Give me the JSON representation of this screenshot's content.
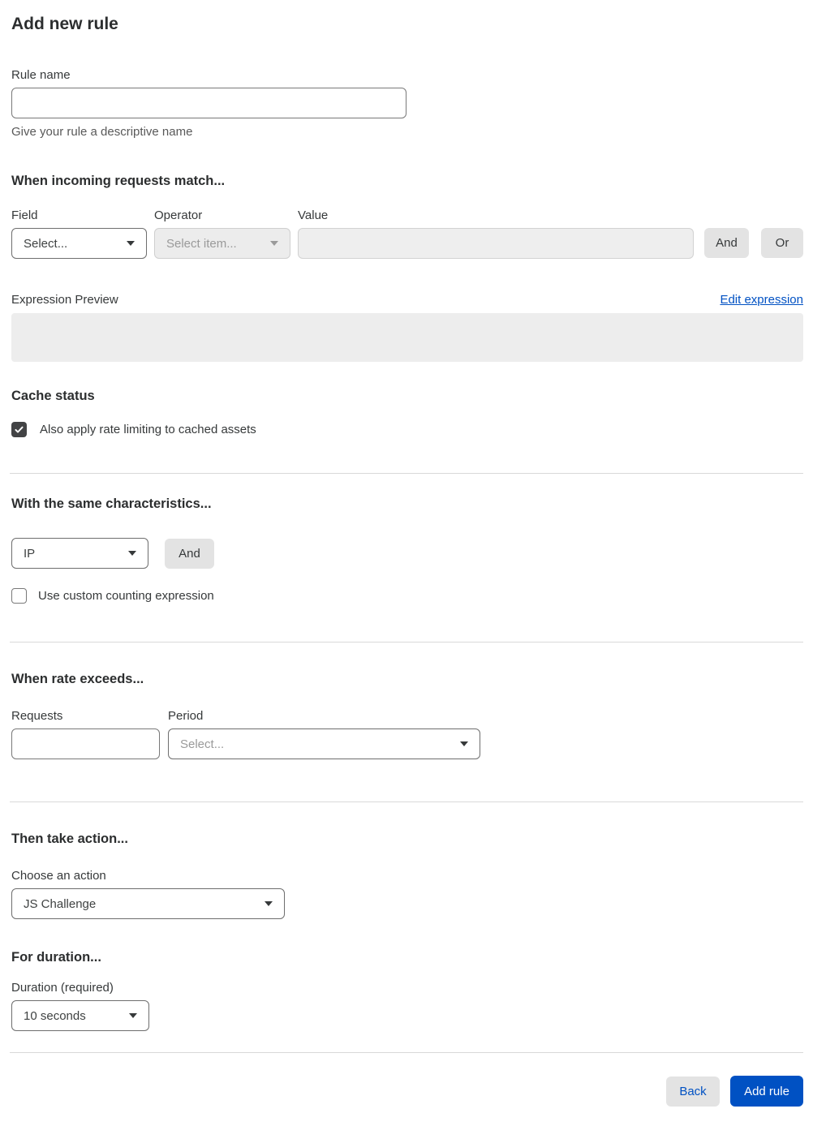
{
  "page": {
    "title": "Add new rule"
  },
  "rule_name": {
    "label": "Rule name",
    "value": "",
    "helper": "Give your rule a descriptive name"
  },
  "match_section": {
    "heading": "When incoming requests match...",
    "field": {
      "label": "Field",
      "selected": "Select..."
    },
    "operator": {
      "label": "Operator",
      "selected": "Select item..."
    },
    "value": {
      "label": "Value",
      "value": ""
    },
    "and_button": "And",
    "or_button": "Or",
    "expression_preview_label": "Expression Preview",
    "edit_expression_link": "Edit expression",
    "expression_value": ""
  },
  "cache_section": {
    "heading": "Cache status",
    "checkbox_label": "Also apply rate limiting to cached assets",
    "checked": true
  },
  "characteristics_section": {
    "heading": "With the same characteristics...",
    "selected": "IP",
    "and_button": "And",
    "checkbox_label": "Use custom counting expression",
    "checked": false
  },
  "rate_section": {
    "heading": "When rate exceeds...",
    "requests": {
      "label": "Requests",
      "value": ""
    },
    "period": {
      "label": "Period",
      "selected": "Select..."
    }
  },
  "action_section": {
    "heading": "Then take action...",
    "label": "Choose an action",
    "selected": "JS Challenge"
  },
  "duration_section": {
    "heading": "For duration...",
    "label": "Duration (required)",
    "selected": "10 seconds"
  },
  "footer": {
    "back_button": "Back",
    "add_rule_button": "Add rule"
  },
  "colors": {
    "accent_blue": "#0051c3",
    "link_blue": "#0051c3",
    "divider_gray": "#d9d9d9"
  }
}
